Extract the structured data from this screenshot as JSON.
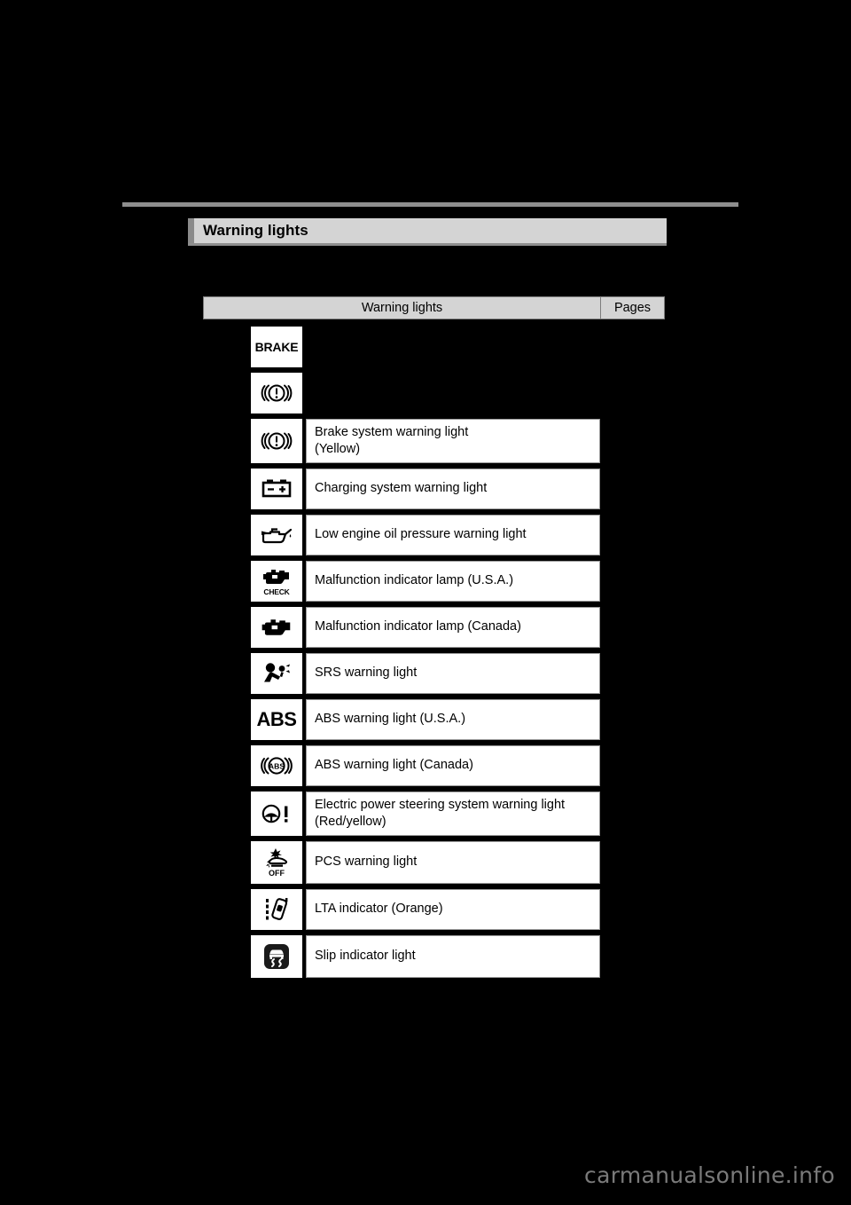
{
  "page": {
    "section_heading": "Warning lights",
    "background_color": "#000000",
    "heading_band_color": "#d4d4d4",
    "heading_accent_color": "#8b8b8b",
    "rule_color": "#8e8e8e",
    "watermark": "carmanualsonline.info"
  },
  "table": {
    "headers": {
      "main": "Warning lights",
      "pages": "Pages"
    },
    "rows": [
      {
        "icon": "brake-text-warning-icon",
        "icon_label": "BRAKE",
        "description": "",
        "pages": ""
      },
      {
        "icon": "brake-system-warning-icon",
        "icon_label": "",
        "description": "",
        "pages": ""
      },
      {
        "icon": "brake-system-warning-yellow-icon",
        "icon_label": "",
        "description": "Brake system warning light\n(Yellow)",
        "pages": ""
      },
      {
        "icon": "charging-system-warning-icon",
        "icon_label": "",
        "description": "Charging system warning light",
        "pages": ""
      },
      {
        "icon": "low-engine-oil-pressure-warning-icon",
        "icon_label": "",
        "description": "Low engine oil pressure warning light",
        "pages": ""
      },
      {
        "icon": "malfunction-indicator-check-icon",
        "icon_label": "CHECK",
        "description": "Malfunction indicator lamp (U.S.A.)",
        "pages": ""
      },
      {
        "icon": "malfunction-indicator-engine-icon",
        "icon_label": "",
        "description": "Malfunction indicator lamp (Canada)",
        "pages": ""
      },
      {
        "icon": "srs-warning-icon",
        "icon_label": "",
        "description": "SRS warning light",
        "pages": ""
      },
      {
        "icon": "abs-text-warning-icon",
        "icon_label": "ABS",
        "description": "ABS warning light (U.S.A.)",
        "pages": ""
      },
      {
        "icon": "abs-symbol-warning-icon",
        "icon_label": "ABS",
        "description": "ABS warning light (Canada)",
        "pages": ""
      },
      {
        "icon": "electric-power-steering-warning-icon",
        "icon_label": "",
        "description": "Electric power steering system warning light\n(Red/yellow)",
        "pages": ""
      },
      {
        "icon": "pcs-warning-off-icon",
        "icon_label": "OFF",
        "description": "PCS warning light",
        "pages": ""
      },
      {
        "icon": "lta-indicator-icon",
        "icon_label": "",
        "description": "LTA indicator (Orange)",
        "pages": ""
      },
      {
        "icon": "slip-indicator-icon",
        "icon_label": "",
        "description": "Slip indicator light",
        "pages": ""
      }
    ]
  }
}
